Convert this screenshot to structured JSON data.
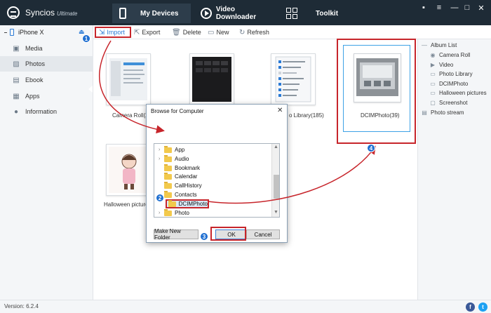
{
  "app": {
    "name": "Syncios",
    "edition": "Ultimate",
    "version_text": "Version: 6.2.4"
  },
  "topnav": {
    "tabs": [
      {
        "label": "My Devices",
        "icon": "phone-icon"
      },
      {
        "label": "Video Downloader",
        "icon": "play-circle-icon"
      },
      {
        "label": "Toolkit",
        "icon": "grid-icon"
      }
    ],
    "window_controls": [
      "message-icon",
      "menu-icon",
      "minimize-icon",
      "maximize-icon",
      "close-icon"
    ],
    "window_glyphs": [
      "▪",
      "≡",
      "—",
      "□",
      "✕"
    ]
  },
  "sidebar": {
    "device_name": "iPhone X",
    "items": [
      {
        "label": "Media",
        "icon": "media-icon",
        "glyph": "▣"
      },
      {
        "label": "Photos",
        "icon": "photos-icon",
        "glyph": "▨"
      },
      {
        "label": "Ebook",
        "icon": "book-icon",
        "glyph": "▤"
      },
      {
        "label": "Apps",
        "icon": "apps-icon",
        "glyph": "▦"
      },
      {
        "label": "Information",
        "icon": "info-icon",
        "glyph": "●"
      }
    ]
  },
  "toolbar": {
    "import_label": "Import",
    "export_label": "Export",
    "delete_label": "Delete",
    "new_label": "New",
    "refresh_label": "Refresh"
  },
  "albums": {
    "camera_roll_label": "Camera Roll(25",
    "photo_library_label": "o Library(185)",
    "dcim_label": "DCIMPhoto(39)",
    "halloween_label": "Halloween picture"
  },
  "album_list": {
    "title": "Album List",
    "items": [
      "Camera Roll",
      "Video",
      "Photo Library",
      "DCIMPhoto",
      "Halloween pictures",
      "Screenshot"
    ],
    "stream": "Photo stream"
  },
  "dialog": {
    "title": "Browse for Computer",
    "folders": [
      "App",
      "Audio",
      "Bookmark",
      "Calendar",
      "CallHistory",
      "Contacts",
      "DCIMPhoto",
      "Photo"
    ],
    "selected_folder": "DCIMPhoto",
    "new_folder_label": "Make New Folder",
    "ok_label": "OK",
    "cancel_label": "Cancel"
  },
  "steps": [
    "1",
    "2",
    "3",
    "4"
  ],
  "colors": {
    "topbar": "#1e2b36",
    "accent": "#2a7ad6",
    "annotation": "#c7252b",
    "badge": "#1f6fd1"
  }
}
